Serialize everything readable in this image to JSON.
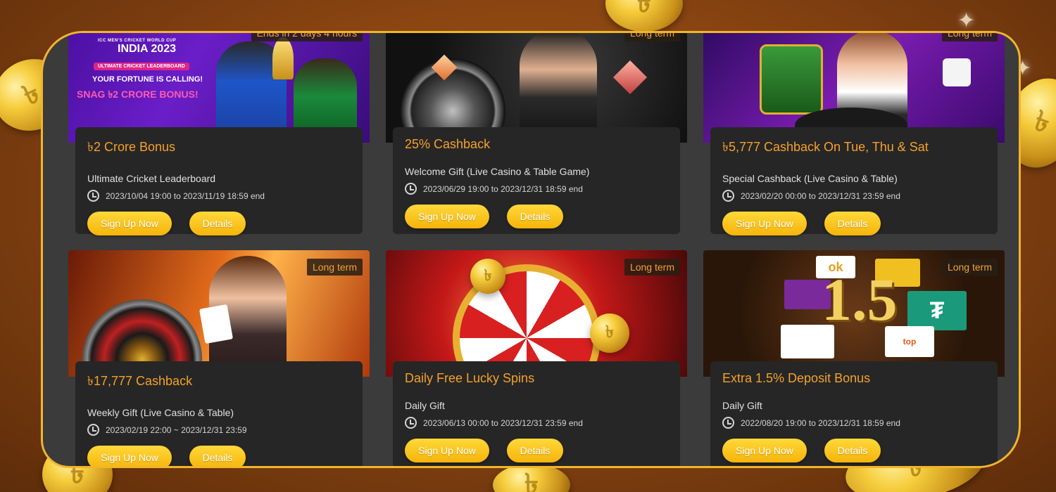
{
  "promotions": [
    {
      "tag": "Ends in 2 days 4 hours",
      "title": "৳2 Crore Bonus",
      "subtitle": "Ultimate Cricket Leaderboard",
      "date": "2023/10/04 19:00  to  2023/11/19 18:59  end",
      "signup": "Sign Up Now",
      "details": "Details",
      "banner": {
        "header": "ICC MEN'S CRICKET WORLD CUP",
        "event": "INDIA 2023",
        "badge": "ULTIMATE CRICKET LEADERBOARD",
        "line1": "YOUR FORTUNE IS CALLING!",
        "line2": "SNAG ৳2 CRORE BONUS!"
      }
    },
    {
      "tag": "Long term",
      "title": "25% Cashback",
      "subtitle": "Welcome Gift (Live Casino & Table Game)",
      "date": "2023/06/29 19:00  to  2023/12/31 18:59  end",
      "signup": "Sign Up Now",
      "details": "Details"
    },
    {
      "tag": "Long term",
      "title": "৳5,777 Cashback On Tue, Thu & Sat",
      "subtitle": "Special Cashback (Live Casino & Table)",
      "date": "2023/02/20 00:00 to 2023/12/31 23:59 end",
      "signup": "Sign Up Now",
      "details": "Details"
    },
    {
      "tag": "Long term",
      "title": "৳17,777 Cashback",
      "subtitle": "Weekly Gift (Live Casino & Table)",
      "date": "2023/02/19 22:00 ~ 2023/12/31 23:59",
      "signup": "Sign Up Now",
      "details": "Details"
    },
    {
      "tag": "Long term",
      "title": "Daily Free Lucky Spins",
      "subtitle": "Daily Gift",
      "date": "2023/06/13 00:00 to 2023/12/31 23:59 end",
      "signup": "Sign Up Now",
      "details": "Details"
    },
    {
      "tag": "Long term",
      "title": "Extra 1.5% Deposit Bonus",
      "subtitle": "Daily Gift",
      "date": "2022/08/20 19:00  to  2023/12/31 18:59  end",
      "signup": "Sign Up Now",
      "details": "Details",
      "banner": {
        "big": "1.5",
        "logo_ok": "ok",
        "logo_top": "top"
      }
    }
  ],
  "colors": {
    "accent": "#f5a12b",
    "frame_border": "#f0b52c",
    "card_bg": "#262626",
    "button": "#f6b40a"
  }
}
